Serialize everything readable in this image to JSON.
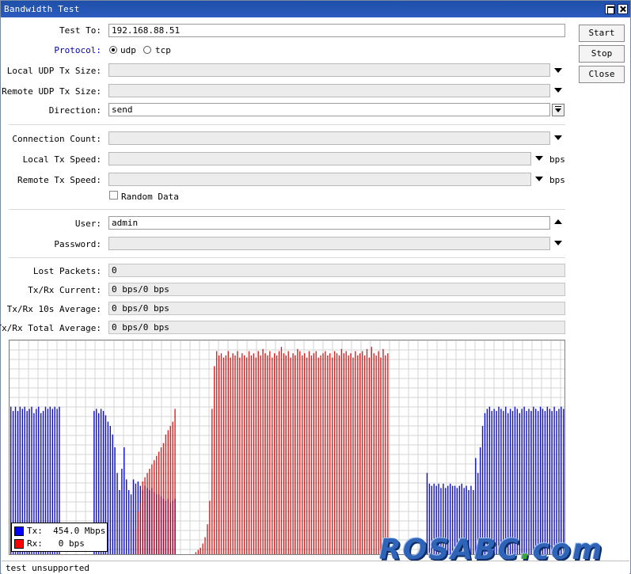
{
  "window": {
    "title": "Bandwidth Test",
    "status": "test unsupported",
    "watermark": "ROSABC.com"
  },
  "buttons": {
    "start": "Start",
    "stop": "Stop",
    "close": "Close"
  },
  "form": {
    "test_to": {
      "label": "Test To:",
      "value": "192.168.88.51"
    },
    "protocol": {
      "label": "Protocol:",
      "options": [
        "udp",
        "tcp"
      ],
      "selected": "udp",
      "label_color": "#0000c0"
    },
    "local_udp_tx_size": {
      "label": "Local UDP Tx Size:",
      "value": ""
    },
    "remote_udp_tx_size": {
      "label": "Remote UDP Tx Size:",
      "value": ""
    },
    "direction": {
      "label": "Direction:",
      "value": "send"
    },
    "connection_count": {
      "label": "Connection Count:",
      "value": ""
    },
    "local_tx_speed": {
      "label": "Local Tx Speed:",
      "value": "",
      "unit": "bps"
    },
    "remote_tx_speed": {
      "label": "Remote Tx Speed:",
      "value": "",
      "unit": "bps"
    },
    "random_data": {
      "label": "Random Data",
      "checked": false
    },
    "user": {
      "label": "User:",
      "value": "admin"
    },
    "password": {
      "label": "Password:",
      "value": ""
    }
  },
  "stats": {
    "lost_packets": {
      "label": "Lost Packets:",
      "value": "0"
    },
    "current": {
      "label": "Tx/Rx Current:",
      "value": "0 bps/0 bps"
    },
    "avg10": {
      "label": "Tx/Rx 10s Average:",
      "value": "0 bps/0 bps"
    },
    "total_avg": {
      "label": "Tx/Rx Total Average:",
      "value": "0 bps/0 bps"
    }
  },
  "legend": {
    "tx": {
      "label": "Tx:",
      "value": "454.0 Mbps",
      "color": "#0000ff"
    },
    "rx": {
      "label": "Rx:",
      "value": "0 bps",
      "color": "#ff0000"
    }
  },
  "chart_data": {
    "type": "bar",
    "grid": true,
    "series": [
      {
        "name": "Tx",
        "color": "#1010c8",
        "values": [
          0.69,
          0.67,
          0.69,
          0.67,
          0.69,
          0.68,
          0.69,
          0.67,
          0.68,
          0.69,
          0.66,
          0.68,
          0.69,
          0.66,
          0.67,
          0.69,
          0.68,
          0.69,
          0.68,
          0.69,
          0.68,
          0.69,
          0,
          0,
          0,
          0,
          0,
          0,
          0,
          0,
          0,
          0,
          0,
          0,
          0,
          0,
          0.67,
          0.68,
          0.66,
          0.68,
          0.67,
          0.65,
          0.62,
          0.6,
          0.56,
          0.5,
          0.38,
          0.3,
          0.4,
          0.5,
          0.35,
          0.3,
          0.28,
          0.35,
          0.33,
          0.34,
          0.32,
          0.3,
          0.32,
          0.31,
          0.3,
          0.31,
          0.29,
          0.28,
          0.28,
          0.27,
          0.26,
          0.25,
          0.26,
          0.24,
          0.25,
          0.26,
          0,
          0,
          0,
          0,
          0,
          0,
          0,
          0,
          0,
          0,
          0,
          0,
          0,
          0,
          0,
          0,
          0,
          0,
          0,
          0,
          0,
          0,
          0,
          0,
          0,
          0,
          0,
          0,
          0,
          0,
          0,
          0,
          0,
          0,
          0,
          0,
          0,
          0,
          0,
          0,
          0,
          0,
          0,
          0,
          0,
          0,
          0,
          0,
          0,
          0,
          0,
          0,
          0,
          0,
          0,
          0,
          0,
          0,
          0,
          0,
          0,
          0,
          0,
          0,
          0,
          0,
          0,
          0,
          0,
          0,
          0,
          0,
          0,
          0,
          0,
          0,
          0,
          0,
          0,
          0,
          0,
          0,
          0,
          0,
          0,
          0,
          0,
          0,
          0,
          0,
          0,
          0,
          0,
          0,
          0,
          0,
          0,
          0,
          0,
          0,
          0,
          0,
          0,
          0,
          0,
          0,
          0,
          0,
          0.38,
          0.33,
          0.32,
          0.33,
          0.32,
          0.33,
          0.31,
          0.33,
          0.31,
          0.32,
          0.33,
          0.32,
          0.32,
          0.31,
          0.32,
          0.33,
          0.31,
          0.32,
          0.3,
          0.32,
          0.3,
          0.45,
          0.38,
          0.5,
          0.6,
          0.66,
          0.68,
          0.69,
          0.67,
          0.68,
          0.67,
          0.69,
          0.68,
          0.67,
          0.69,
          0.66,
          0.68,
          0.67,
          0.69,
          0.68,
          0.66,
          0.68,
          0.69,
          0.67,
          0.68,
          0.67,
          0.69,
          0.68,
          0.67,
          0.69,
          0.68,
          0.67,
          0.69,
          0.68,
          0.67,
          0.69,
          0.67,
          0.68,
          0.69,
          0.68
        ]
      },
      {
        "name": "Rx",
        "color": "#cc0000",
        "values": [
          0,
          0,
          0,
          0,
          0,
          0,
          0,
          0,
          0,
          0,
          0,
          0,
          0,
          0,
          0,
          0,
          0,
          0,
          0,
          0,
          0,
          0,
          0,
          0,
          0,
          0,
          0,
          0,
          0,
          0,
          0,
          0,
          0,
          0,
          0,
          0,
          0,
          0,
          0,
          0,
          0,
          0,
          0,
          0,
          0,
          0,
          0,
          0,
          0,
          0,
          0,
          0,
          0,
          0,
          0.12,
          0.2,
          0.24,
          0.34,
          0.36,
          0.38,
          0.4,
          0.42,
          0.44,
          0.46,
          0.48,
          0.5,
          0.52,
          0.56,
          0.58,
          0.6,
          0.62,
          0.68,
          0,
          0,
          0,
          0,
          0,
          0,
          0,
          0,
          0.01,
          0.02,
          0.03,
          0.05,
          0.08,
          0.14,
          0.25,
          0.68,
          0.88,
          0.95,
          0.93,
          0.94,
          0.92,
          0.93,
          0.95,
          0.92,
          0.94,
          0.93,
          0.95,
          0.92,
          0.94,
          0.93,
          0.92,
          0.95,
          0.93,
          0.94,
          0.92,
          0.95,
          0.93,
          0.96,
          0.94,
          0.93,
          0.95,
          0.92,
          0.94,
          0.93,
          0.95,
          0.97,
          0.94,
          0.93,
          0.95,
          0.92,
          0.94,
          0.93,
          0.96,
          0.95,
          0.93,
          0.94,
          0.92,
          0.95,
          0.93,
          0.94,
          0.95,
          0.92,
          0.93,
          0.94,
          0.95,
          0.93,
          0.94,
          0.92,
          0.95,
          0.94,
          0.93,
          0.96,
          0.94,
          0.95,
          0.93,
          0.94,
          0.92,
          0.95,
          0.93,
          0.94,
          0.95,
          0.93,
          0.96,
          0.92,
          0.97,
          0.94,
          0.93,
          0.95,
          0.92,
          0.96,
          0.93,
          0.94,
          0,
          0,
          0,
          0,
          0,
          0,
          0,
          0,
          0,
          0,
          0,
          0,
          0,
          0,
          0,
          0,
          0,
          0,
          0,
          0,
          0,
          0,
          0,
          0,
          0,
          0,
          0,
          0,
          0,
          0,
          0,
          0,
          0,
          0,
          0,
          0,
          0,
          0,
          0,
          0,
          0,
          0,
          0,
          0,
          0,
          0,
          0,
          0,
          0,
          0,
          0,
          0,
          0,
          0,
          0,
          0,
          0,
          0,
          0,
          0,
          0,
          0,
          0,
          0,
          0,
          0,
          0,
          0
        ]
      }
    ]
  }
}
